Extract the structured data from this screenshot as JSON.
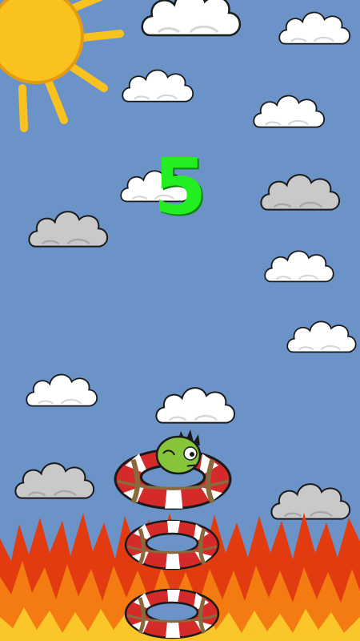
{
  "game": {
    "score": "5",
    "score_color": "#22ee22",
    "sky_color": "#6b93c8",
    "fire_colors": [
      "#e23b10",
      "#f47a12",
      "#fbc62a"
    ],
    "sun_color": "#f9c21e",
    "ring_colors": [
      "#d42a2a",
      "#ffffff",
      "#8a6a3c"
    ],
    "character_color": "#86c43a"
  },
  "sprites": {
    "sun": "sun-icon",
    "clouds_white": "cloud-icon",
    "clouds_gray": "storm-cloud-icon",
    "rings": "life-ring-icon",
    "character": "green-creature-icon",
    "fire": "fire-icon"
  }
}
